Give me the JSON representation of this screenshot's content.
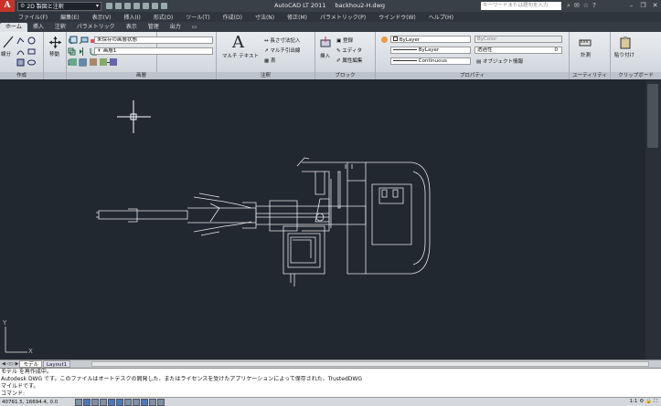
{
  "app": {
    "logo_letter": "A",
    "workspace": "2D 製図と注釈",
    "title": "AutoCAD LT 2011",
    "filename": "backhou2-H.dwg",
    "search_placeholder": "キーワードまたは語句を入力"
  },
  "menubar": {
    "items": [
      "ファイル(F)",
      "編集(E)",
      "表示(V)",
      "挿入(I)",
      "形式(O)",
      "ツール(T)",
      "作成(D)",
      "寸法(N)",
      "修正(M)",
      "パラメトリック(P)",
      "ウインドウ(W)",
      "ヘルプ(H)"
    ]
  },
  "ribbon_tabs": {
    "items": [
      "ホーム",
      "挿入",
      "注釈",
      "パラメトリック",
      "表示",
      "管理",
      "出力"
    ],
    "active": "ホーム"
  },
  "ribbon": {
    "draw_panel": {
      "title": "作成",
      "line": "線分"
    },
    "modify_panel": {
      "title": "修正",
      "move": "移動"
    },
    "layers_panel": {
      "title": "画層",
      "state_dropdown": "未保存の画層状態",
      "layer_dropdown": "画層1"
    },
    "annotation_panel": {
      "title": "注釈",
      "multitext": "マルチ テキスト",
      "linear_dim": "長さ寸法記入",
      "mleader": "マルチ引出線",
      "table": "表"
    },
    "block_panel": {
      "title": "ブロック",
      "insert": "挿入",
      "create": "登録",
      "edit": "エディタ",
      "attr_edit": "属性編集"
    },
    "properties_panel": {
      "title": "プロパティ",
      "color": "ByLayer",
      "lineweight": "ByLayer",
      "linetype": "Continuous",
      "layer_color": "ByColor",
      "transparency": "透過性",
      "transparency_value": "0",
      "object_info": "オブジェクト情報"
    },
    "utility_panel": {
      "title": "ユーティリティ",
      "measure": "計測"
    },
    "clipboard_panel": {
      "title": "クリップボード",
      "paste": "貼り付け"
    }
  },
  "layout_tabs": {
    "items": [
      "モデル",
      "Layout1"
    ],
    "active": "モデル"
  },
  "command": {
    "lines": [
      "モデル を再作成中。",
      "Autodesk DWG です。このファイルはオートデスクの開発した、またはライセンスを受けたアプリケーションによって保存された、TrustedDWG",
      "マイルドです。",
      "コマンド:"
    ]
  },
  "status": {
    "coords": "40761.5, 16694.4, 0.0",
    "annotation_scale": "1:1"
  },
  "colors": {
    "canvas": "#212830",
    "crosshair": "#ffffff",
    "drawing": "#e8e8e8",
    "logo": "#c8322a"
  }
}
